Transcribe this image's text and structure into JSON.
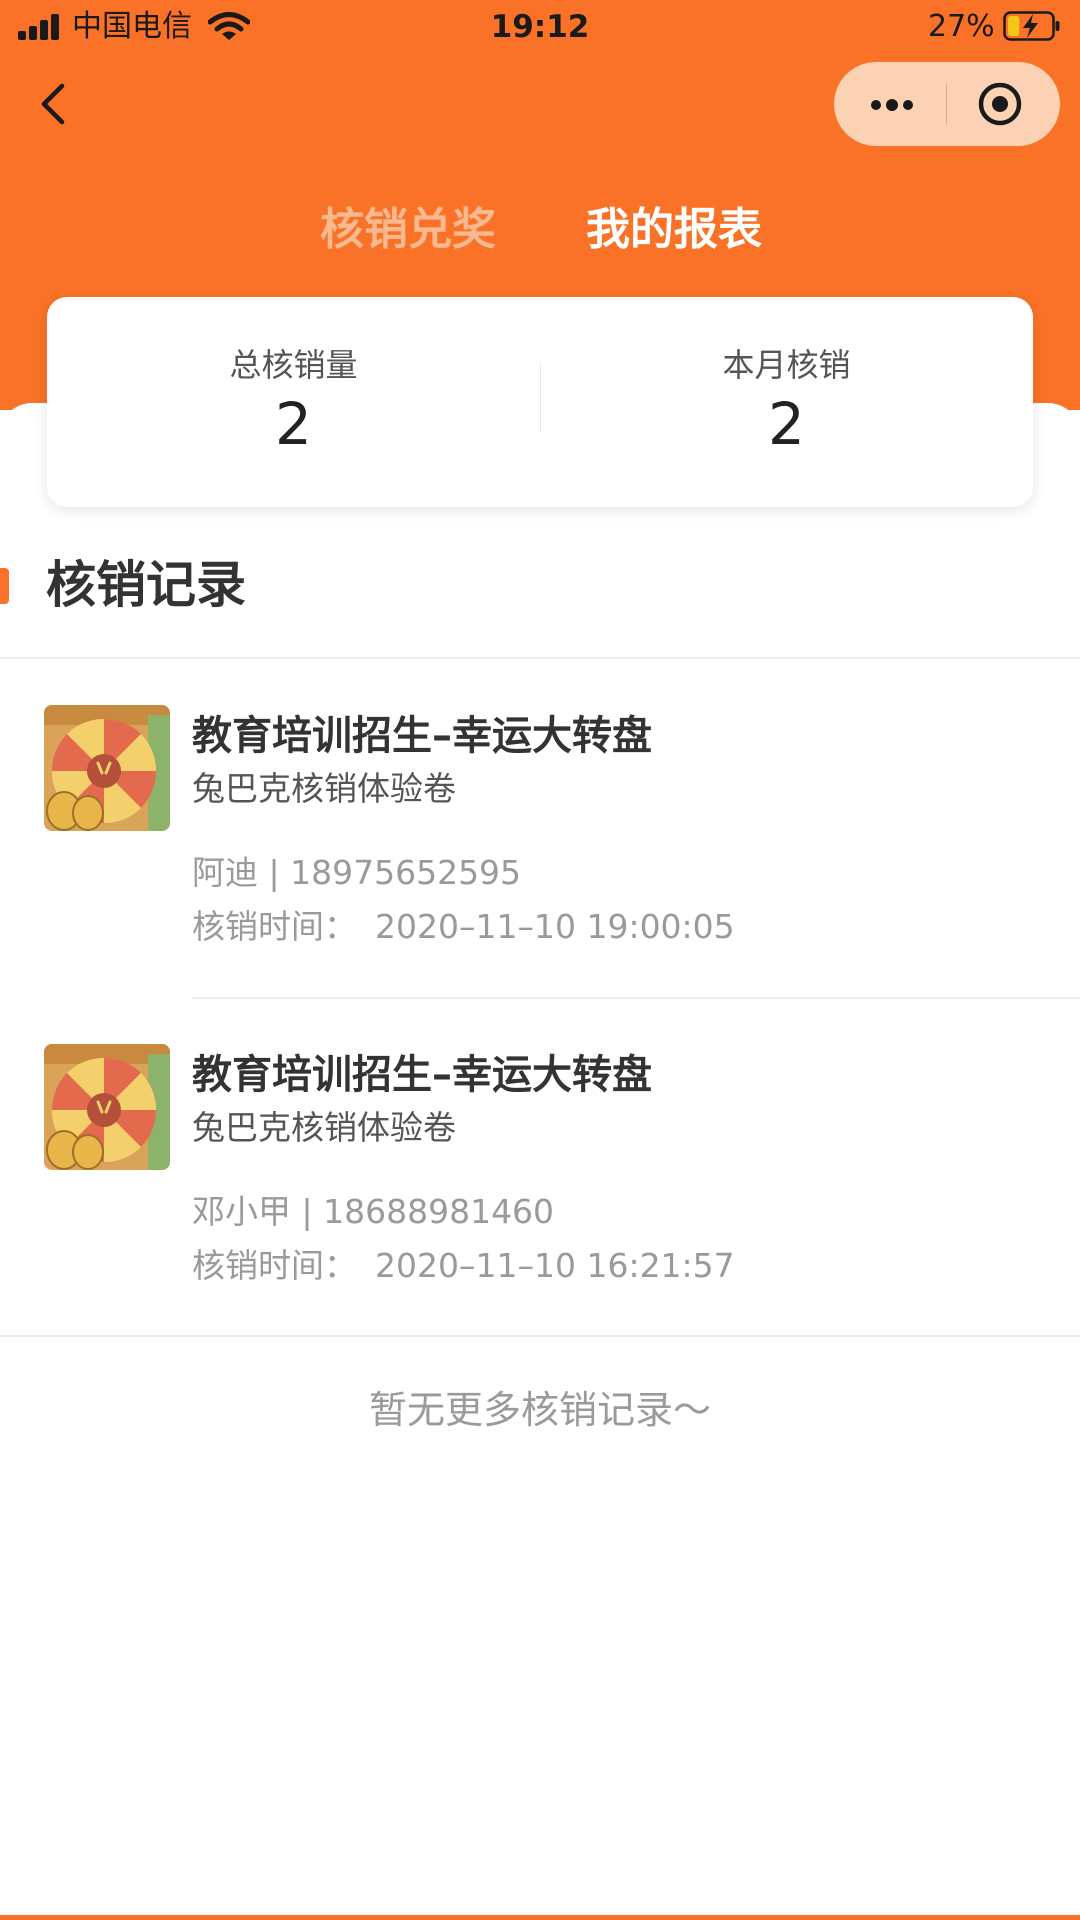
{
  "status_bar": {
    "carrier": "中国电信",
    "time": "19:12",
    "battery": "27%",
    "battery_level": 0.27
  },
  "nav": {
    "back_icon": "chevron-left-icon",
    "more_icon": "more-dots-icon",
    "close_icon": "target-circle-icon"
  },
  "tabs": [
    {
      "label": "核销兑奖",
      "active": false
    },
    {
      "label": "我的报表",
      "active": true
    }
  ],
  "stats": {
    "total_label": "总核销量",
    "total_value": "2",
    "month_label": "本月核销",
    "month_value": "2"
  },
  "section": {
    "title": "核销记录"
  },
  "records": [
    {
      "title": "教育培训招生–幸运大转盘",
      "subtitle": "兔巴克核销体验卷",
      "contact": "阿迪 | 18975652595",
      "time_label": "核销时间：",
      "time_value": "2020–11–10 19:00:05"
    },
    {
      "title": "教育培训招生–幸运大转盘",
      "subtitle": "兔巴克核销体验卷",
      "contact": "邓小甲 | 18688981460",
      "time_label": "核销时间：",
      "time_value": "2020–11–10 16:21:57"
    }
  ],
  "footer": {
    "no_more": "暂无更多核销记录～"
  },
  "colors": {
    "brand": "#F97227",
    "tab_inactive": "#F8B98F",
    "muted_text": "#9a9a9a"
  }
}
